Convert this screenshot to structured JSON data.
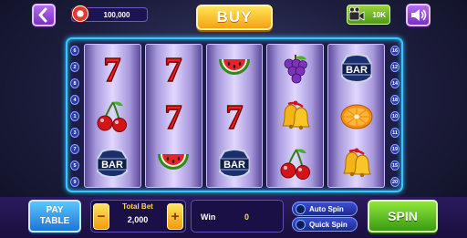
{
  "top_bar": {
    "coins": "100,000",
    "buy_label": "BUY",
    "bonus_label": "10K"
  },
  "paylines": {
    "left": [
      "6",
      "2",
      "8",
      "4",
      "1",
      "3",
      "7",
      "5",
      "9"
    ],
    "right": [
      "16",
      "12",
      "14",
      "18",
      "10",
      "11",
      "19",
      "15",
      "20"
    ]
  },
  "reels": [
    [
      "seven",
      "cherry",
      "bar"
    ],
    [
      "seven",
      "seven",
      "watermelon"
    ],
    [
      "watermelon",
      "seven",
      "bar"
    ],
    [
      "grapes",
      "bell",
      "cherry"
    ],
    [
      "bar",
      "orange",
      "bell"
    ]
  ],
  "symbol_text": {
    "bar": "BAR",
    "seven": "7"
  },
  "bottom_bar": {
    "pay_table_line1": "PAY",
    "pay_table_line2": "TABLE",
    "minus_label": "−",
    "plus_label": "+",
    "total_bet_label": "Total Bet",
    "total_bet_value": "2,000",
    "win_label": "Win",
    "win_value": "0",
    "auto_spin_label": "Auto Spin",
    "quick_spin_label": "Quick Spin",
    "spin_label": "SPIN"
  },
  "colors": {
    "frame_glow": "#36c7ff",
    "buy": "#f6a20f",
    "spin": "#3a9a12",
    "purple_button": "#7b2fc4"
  }
}
